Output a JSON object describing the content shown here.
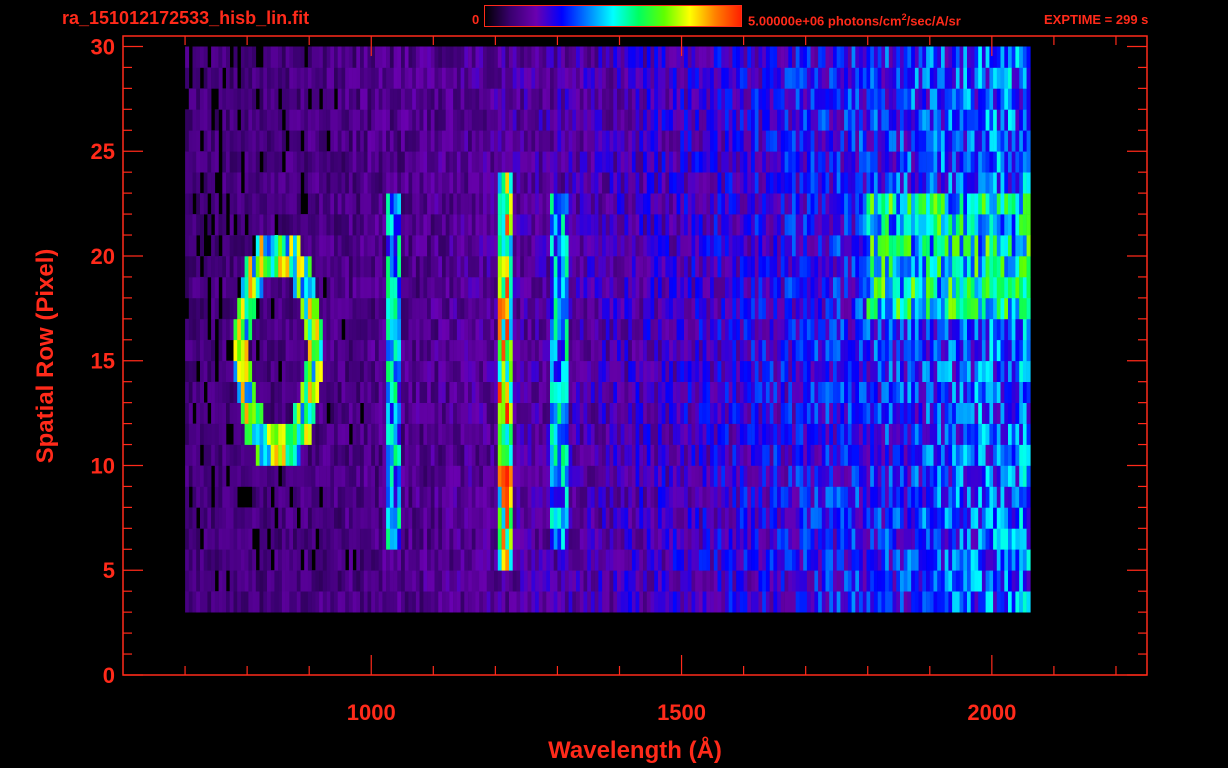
{
  "header": {
    "filename": "ra_151012172533_hisb_lin.fit",
    "colorbar_min": "0",
    "colorbar_max_prefix": "5.00000e+06 photons/cm",
    "colorbar_max_sup": "2",
    "colorbar_max_suffix": "/sec/A/sr",
    "exptime": "EXPTIME = 299 s"
  },
  "colors": {
    "axis": "#ff2a1a",
    "background": "#000000",
    "colormap": [
      "#000000",
      "#3a0070",
      "#6a00b0",
      "#0000ff",
      "#0080ff",
      "#00ffff",
      "#00ff60",
      "#60ff00",
      "#ffff00",
      "#ff8000",
      "#ff2000"
    ]
  },
  "chart_data": {
    "type": "heatmap",
    "title": "ra_151012172533_hisb_lin.fit",
    "xlabel": "Wavelength (Å)",
    "ylabel": "Spatial Row (Pixel)",
    "xlim": [
      600,
      2250
    ],
    "ylim": [
      0,
      30.5
    ],
    "xticks": [
      1000,
      1500,
      2000
    ],
    "xtick_labels": [
      "1000",
      "1500",
      "2000"
    ],
    "yticks": [
      0,
      5,
      10,
      15,
      20,
      25,
      30
    ],
    "ytick_labels": [
      "0",
      "5",
      "10",
      "15",
      "20",
      "25",
      "30"
    ],
    "colorbar_range": [
      0,
      5000000
    ],
    "data_extent": {
      "wavelength": [
        700,
        2060
      ],
      "rows": [
        3,
        30
      ]
    },
    "features": [
      {
        "name": "ring",
        "center_wavelength": 850,
        "center_row": 15.5,
        "row_range": [
          10,
          21
        ],
        "level": 0.65
      },
      {
        "name": "emission line",
        "wavelength": 1035,
        "row_range": [
          6,
          23
        ],
        "level": 0.45
      },
      {
        "name": "emission line",
        "wavelength": 1216,
        "row_range": [
          5,
          24
        ],
        "level": 0.75
      },
      {
        "name": "emission line",
        "wavelength": 1304,
        "row_range": [
          6,
          23
        ],
        "level": 0.45
      },
      {
        "name": "bright region",
        "wavelength_range": [
          1800,
          2060
        ],
        "row_range": [
          17,
          23
        ],
        "level": 0.55
      }
    ]
  }
}
